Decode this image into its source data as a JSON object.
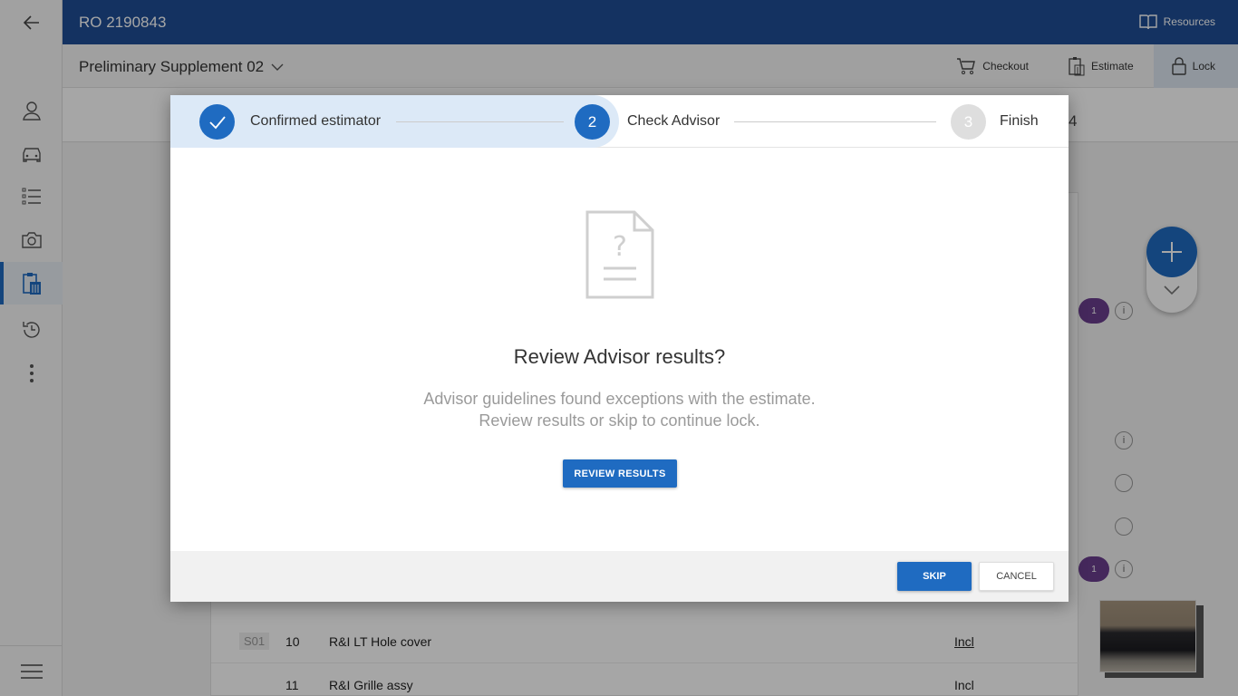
{
  "topbar": {
    "ro_title": "RO 2190843",
    "resources_label": "Resources"
  },
  "subbar": {
    "title": "Preliminary Supplement 02",
    "actions": {
      "checkout": "Checkout",
      "estimate": "Estimate",
      "lock": "Lock"
    }
  },
  "background": {
    "strip_peek": "4",
    "rows": [
      {
        "badge": "S01",
        "num": "10",
        "desc": "R&I LT Hole cover",
        "incl": "Incl"
      },
      {
        "badge": "",
        "num": "11",
        "desc": "R&I Grille assy",
        "incl": "Incl"
      }
    ],
    "purple_badges": [
      "1",
      "1"
    ]
  },
  "modal": {
    "steps": [
      {
        "number": "1",
        "label": "Confirmed estimator",
        "state": "done"
      },
      {
        "number": "2",
        "label": "Check Advisor",
        "state": "active"
      },
      {
        "number": "3",
        "label": "Finish",
        "state": "pending"
      }
    ],
    "title": "Review Advisor results?",
    "text_line1": "Advisor guidelines found exceptions with the estimate.",
    "text_line2": "Review results or skip to continue lock.",
    "review_button": "REVIEW RESULTS",
    "skip_button": "SKIP",
    "cancel_button": "CANCEL"
  },
  "colors": {
    "primary": "#1f6bc1",
    "header": "#1f4e95",
    "accent_purple": "#6b3e8e"
  },
  "icons": {
    "rail": [
      "back-arrow-icon",
      "user-icon",
      "car-icon",
      "list-icon",
      "camera-icon",
      "estimate-clipboard-icon",
      "history-icon",
      "more-vert-icon",
      "menu-icon"
    ],
    "modal": "document-question-icon"
  }
}
